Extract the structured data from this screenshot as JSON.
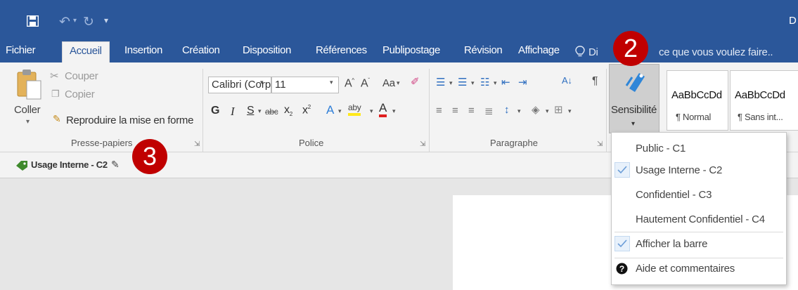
{
  "window": {
    "title_partial": "D"
  },
  "tabs": [
    "Fichier",
    "Accueil",
    "Insertion",
    "Création",
    "Disposition",
    "Références",
    "Publipostage",
    "Révision",
    "Affichage"
  ],
  "active_tab": "Accueil",
  "tell_me": {
    "part1": "Di",
    "part2": "ce que vous voulez faire.."
  },
  "clipboard": {
    "paste": "Coller",
    "cut": "Couper",
    "copy": "Copier",
    "format_painter": "Reproduire la mise en forme",
    "label": "Presse-papiers"
  },
  "font": {
    "name": "Calibri (Corp",
    "size": "11",
    "label": "Police",
    "change_case": "Aa",
    "bold": "G",
    "italic": "I",
    "underline": "S",
    "strike": "abc",
    "sub": "x",
    "sup": "x",
    "highlight": "aby",
    "color_a": "A"
  },
  "paragraph": {
    "label": "Paragraphe",
    "pilcrow": "¶"
  },
  "sensitivity": {
    "label": "Sensibilité"
  },
  "styles": [
    {
      "preview": "AaBbCcDd",
      "name": "¶ Normal"
    },
    {
      "preview": "AaBbCcDd",
      "name": "¶ Sans int..."
    }
  ],
  "classification_bar": {
    "label": "Usage Interne - C2"
  },
  "menu": {
    "items": [
      {
        "label": "Public - C1",
        "checked": false
      },
      {
        "label": "Usage Interne - C2",
        "checked": true
      },
      {
        "label": "Confidentiel - C3",
        "checked": false
      },
      {
        "label": "Hautement Confidentiel - C4",
        "checked": false
      }
    ],
    "show_bar": {
      "label": "Afficher la barre",
      "checked": true
    },
    "help": {
      "label": "Aide et commentaires"
    }
  },
  "callouts": {
    "two": "2",
    "three": "3"
  },
  "colors": {
    "title_blue": "#2b579a",
    "ribbon_gray": "#f3f3f3",
    "callout_red": "#c00000",
    "label_green": "#3f8a2c",
    "checked_bg": "#e8f1fb"
  }
}
